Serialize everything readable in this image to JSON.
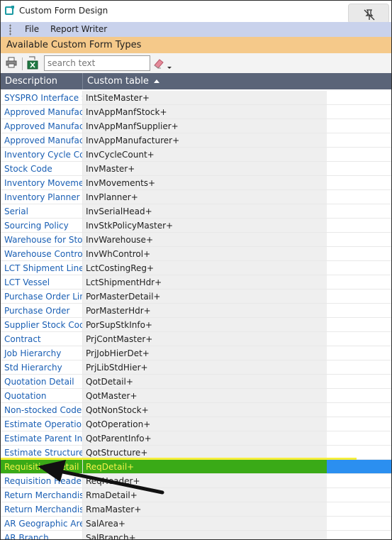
{
  "window": {
    "title": "Custom Form Design"
  },
  "menu": {
    "file": "File",
    "report_writer": "Report Writer"
  },
  "section": {
    "title": "Available Custom Form Types"
  },
  "toolbar": {
    "search_placeholder": "search text"
  },
  "grid": {
    "columns": [
      "Description",
      "Custom table"
    ],
    "sorted_column": "Custom table",
    "sort_direction": "ascending",
    "selected_row_index": 26,
    "rows": [
      {
        "description": "SYSPRO Interface S...",
        "table": "IntSiteMaster+"
      },
      {
        "description": "Approved Manufac...",
        "table": "InvAppManfStock+"
      },
      {
        "description": "Approved Manufac...",
        "table": "InvAppManfSupplier+"
      },
      {
        "description": "Approved Manufac...",
        "table": "InvAppManufacturer+"
      },
      {
        "description": "Inventory Cycle Co...",
        "table": "InvCycleCount+"
      },
      {
        "description": "Stock Code",
        "table": "InvMaster+"
      },
      {
        "description": "Inventory Moveme...",
        "table": "InvMovements+"
      },
      {
        "description": "Inventory Planner",
        "table": "InvPlanner+"
      },
      {
        "description": "Serial",
        "table": "InvSerialHead+"
      },
      {
        "description": "Sourcing Policy",
        "table": "InvStkPolicyMaster+"
      },
      {
        "description": "Warehouse for Sto...",
        "table": "InvWarehouse+"
      },
      {
        "description": "Warehouse Control",
        "table": "InvWhControl+"
      },
      {
        "description": "LCT Shipment Line",
        "table": "LctCostingReg+"
      },
      {
        "description": "LCT Vessel",
        "table": "LctShipmentHdr+"
      },
      {
        "description": "Purchase Order Line",
        "table": "PorMasterDetail+"
      },
      {
        "description": "Purchase Order",
        "table": "PorMasterHdr+"
      },
      {
        "description": "Supplier Stock Code",
        "table": "PorSupStkInfo+"
      },
      {
        "description": "Contract",
        "table": "PrjContMaster+"
      },
      {
        "description": "Job Hierarchy",
        "table": "PrjJobHierDet+"
      },
      {
        "description": "Std Hierarchy",
        "table": "PrjLibStdHier+"
      },
      {
        "description": "Quotation Detail",
        "table": "QotDetail+"
      },
      {
        "description": "Quotation",
        "table": "QotMaster+"
      },
      {
        "description": "Non-stocked Code",
        "table": "QotNonStock+"
      },
      {
        "description": "Estimate Operation",
        "table": "QotOperation+"
      },
      {
        "description": "Estimate Parent Inf...",
        "table": "QotParentInfo+"
      },
      {
        "description": "Estimate Structure",
        "table": "QotStructure+"
      },
      {
        "description": "Requisition Detail",
        "table": "ReqDetail+"
      },
      {
        "description": "Requisition Header",
        "table": "ReqHeader+"
      },
      {
        "description": "Return Merchandis...",
        "table": "RmaDetail+"
      },
      {
        "description": "Return Merchandis...",
        "table": "RmaMaster+"
      },
      {
        "description": "AR Geographic Area",
        "table": "SalArea+"
      },
      {
        "description": "AR Branch",
        "table": "SalBranch+"
      }
    ]
  },
  "colors": {
    "menubar": "#c9d2ec",
    "section_header": "#f5c98a",
    "grid_header": "#5a6478",
    "selected_row": "#3aaa17",
    "selected_text": "#f3f24a",
    "link_text": "#1a5fb4"
  },
  "icons": {
    "app": "app-icon",
    "pin": "unpin-icon",
    "print": "printer-icon",
    "excel": "excel-export-icon",
    "clear": "eraser-icon",
    "annotation": "arrow-annotation"
  }
}
